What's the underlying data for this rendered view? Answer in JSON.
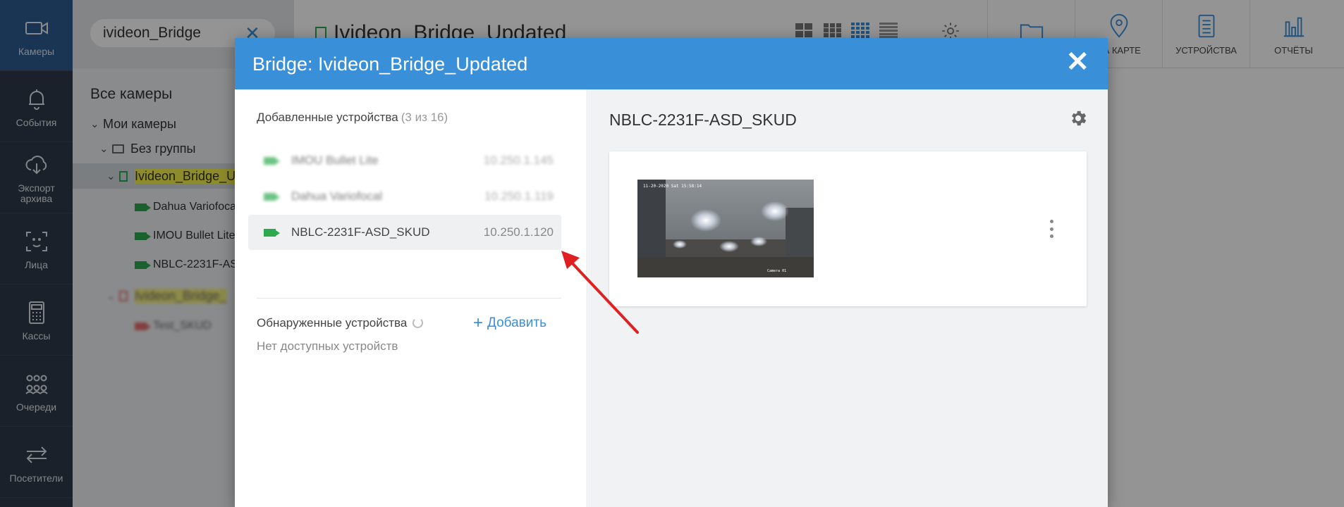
{
  "rail": [
    {
      "label": "Камеры",
      "icon": "camera-icon"
    },
    {
      "label": "События",
      "icon": "bell-icon"
    },
    {
      "label": "Экспорт архива",
      "icon": "cloud-download-icon"
    },
    {
      "label": "Лица",
      "icon": "face-scan-icon"
    },
    {
      "label": "Кассы",
      "icon": "calculator-icon"
    },
    {
      "label": "Очереди",
      "icon": "people-icon"
    },
    {
      "label": "Посетители",
      "icon": "arrows-exchange-icon"
    }
  ],
  "tree": {
    "search_value": "ivideon_Bridge",
    "title": "Все камеры",
    "my_cameras": "Мои камеры",
    "no_group": "Без группы",
    "bridge_1": "Ivideon_Bridge_U",
    "cam_1": "Dahua Variofoca",
    "cam_2": "IMOU Bullet Lite",
    "cam_3": "NBLC-2231F-AS",
    "bridge_2": "Ivideon_Bridge_",
    "cam_4": "Test_SKUD"
  },
  "topbar": {
    "title": "Ivideon_Bridge_Updated",
    "buttons": [
      {
        "label": "",
        "icon": "folder-icon"
      },
      {
        "label": "НА КАРТЕ",
        "icon": "map-pin-icon"
      },
      {
        "label": "УСТРОЙСТВА",
        "icon": "devices-icon"
      },
      {
        "label": "ОТЧЁТЫ",
        "icon": "bar-chart-icon"
      }
    ]
  },
  "dialog": {
    "title": "Bridge: Ivideon_Bridge_Updated",
    "added_title": "Добавленные устройства",
    "added_count": "(3 из 16)",
    "devices": [
      {
        "name": "IMOU Bullet Lite",
        "ip": "10.250.1.145"
      },
      {
        "name": "Dahua Variofocal",
        "ip": "10.250.1.119"
      },
      {
        "name": "NBLC-2231F-ASD_SKUD",
        "ip": "10.250.1.120"
      }
    ],
    "discovered_title": "Обнаруженные устройства",
    "add_label": "Добавить",
    "empty_text": "Нет доступных устройств",
    "selected_device": "NBLC-2231F-ASD_SKUD",
    "thumb_timestamp": "11-20-2020 Sat 15:58:14",
    "thumb_caption": "Camera 01"
  },
  "colors": {
    "rail_bg": "#2f3a4a",
    "rail_active": "#2c5c8f",
    "accent": "#3a8fd9",
    "camera_online": "#2eaa4e",
    "camera_offline": "#dd3333",
    "highlight": "#f4f04a",
    "arrow": "#e02020"
  }
}
